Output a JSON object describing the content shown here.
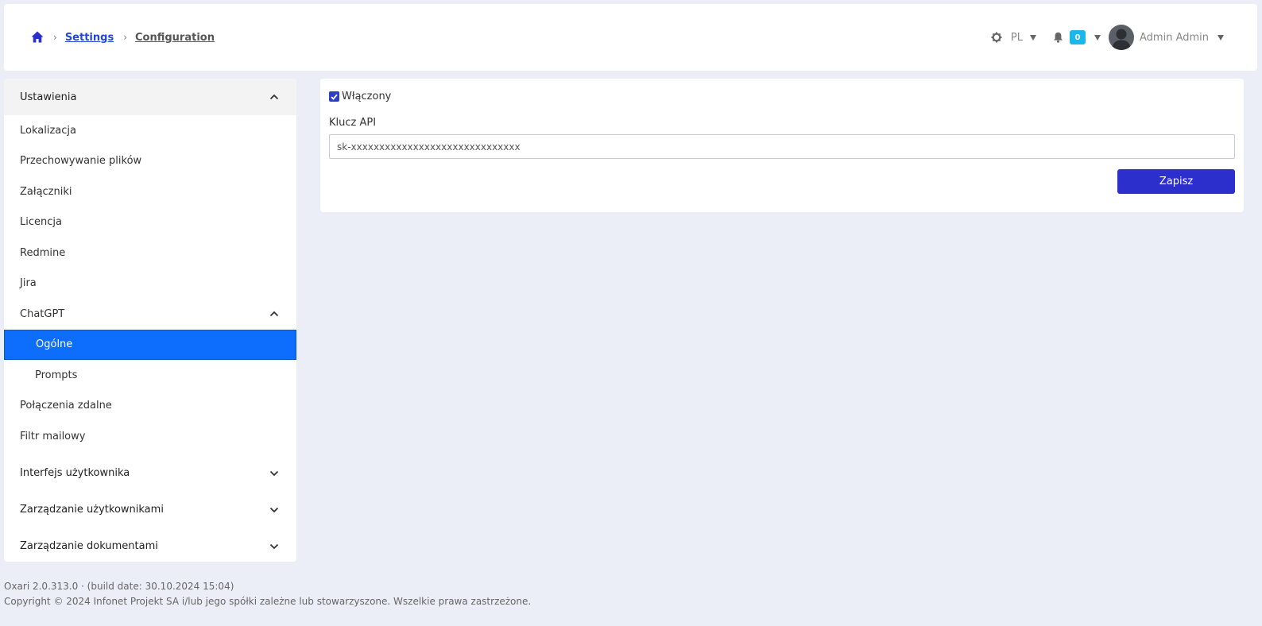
{
  "header": {
    "breadcrumb": {
      "home_icon": "home-icon",
      "items": [
        "Settings",
        "Configuration"
      ]
    },
    "language": "PL",
    "notifications_count": "0",
    "user_name": "Admin Admin",
    "icons": [
      "gear-icon",
      "bell-icon",
      "avatar",
      "caret-down-icon"
    ]
  },
  "sidebar": {
    "section_title": "Ustawienia",
    "items": [
      "Lokalizacja",
      "Przechowywanie plików",
      "Załączniki",
      "Licencja",
      "Redmine",
      "Jira"
    ],
    "chatgpt": {
      "label": "ChatGPT",
      "children": [
        "Ogólne",
        "Prompts"
      ],
      "active": "Ogólne"
    },
    "items_after": [
      "Połączenia zdalne",
      "Filtr mailowy"
    ],
    "collapsed_sections": [
      "Interfejs użytkownika",
      "Zarządzanie użytkownikami",
      "Zarządzanie dokumentami"
    ]
  },
  "form": {
    "enabled_label": "Włączony",
    "enabled_checked": true,
    "api_key_label": "Klucz API",
    "api_key_value": "sk-xxxxxxxxxxxxxxxxxxxxxxxxxxxxxx",
    "save_label": "Zapisz"
  },
  "footer": {
    "version": "Oxari 2.0.313.0 · (build date: 30.10.2024 15:04)",
    "copyright": "Copyright © 2024 Infonet Projekt SA i/lub jego spółki zależne lub stowarzyszone. Wszelkie prawa zastrzeżone."
  },
  "colors": {
    "background": "#eceef7",
    "active_item": "#0d6efd",
    "primary_button": "#2d2fcc",
    "link": "#2446d8",
    "badge": "#1ab7ea"
  }
}
